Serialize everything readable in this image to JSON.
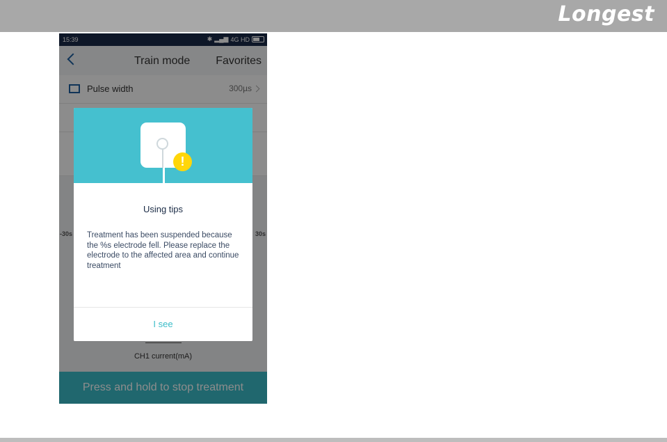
{
  "brand": {
    "logo_text": "Longest"
  },
  "status_bar": {
    "time": "15:39",
    "network": "4G HD"
  },
  "nav": {
    "title": "Train mode",
    "favorites": "Favorites"
  },
  "settings": {
    "pulse_width": {
      "label": "Pulse width",
      "value": "300µs"
    }
  },
  "graph": {
    "left_label": "-30s",
    "right_label": "30s"
  },
  "channel": {
    "label": "CH1 current(mA)"
  },
  "bottom_button": {
    "label": "Press and hold to stop treatment"
  },
  "dialog": {
    "title": "Using tips",
    "message": "Treatment has been suspended because the %s electrode fell. Please replace the electrode to the affected area and continue treatment",
    "button": "I see",
    "warning_glyph": "!"
  },
  "colors": {
    "accent": "#3bbcc8",
    "dialog_header": "#45c0cf",
    "warning": "#ffd60a",
    "status_bar": "#1b2a49"
  }
}
